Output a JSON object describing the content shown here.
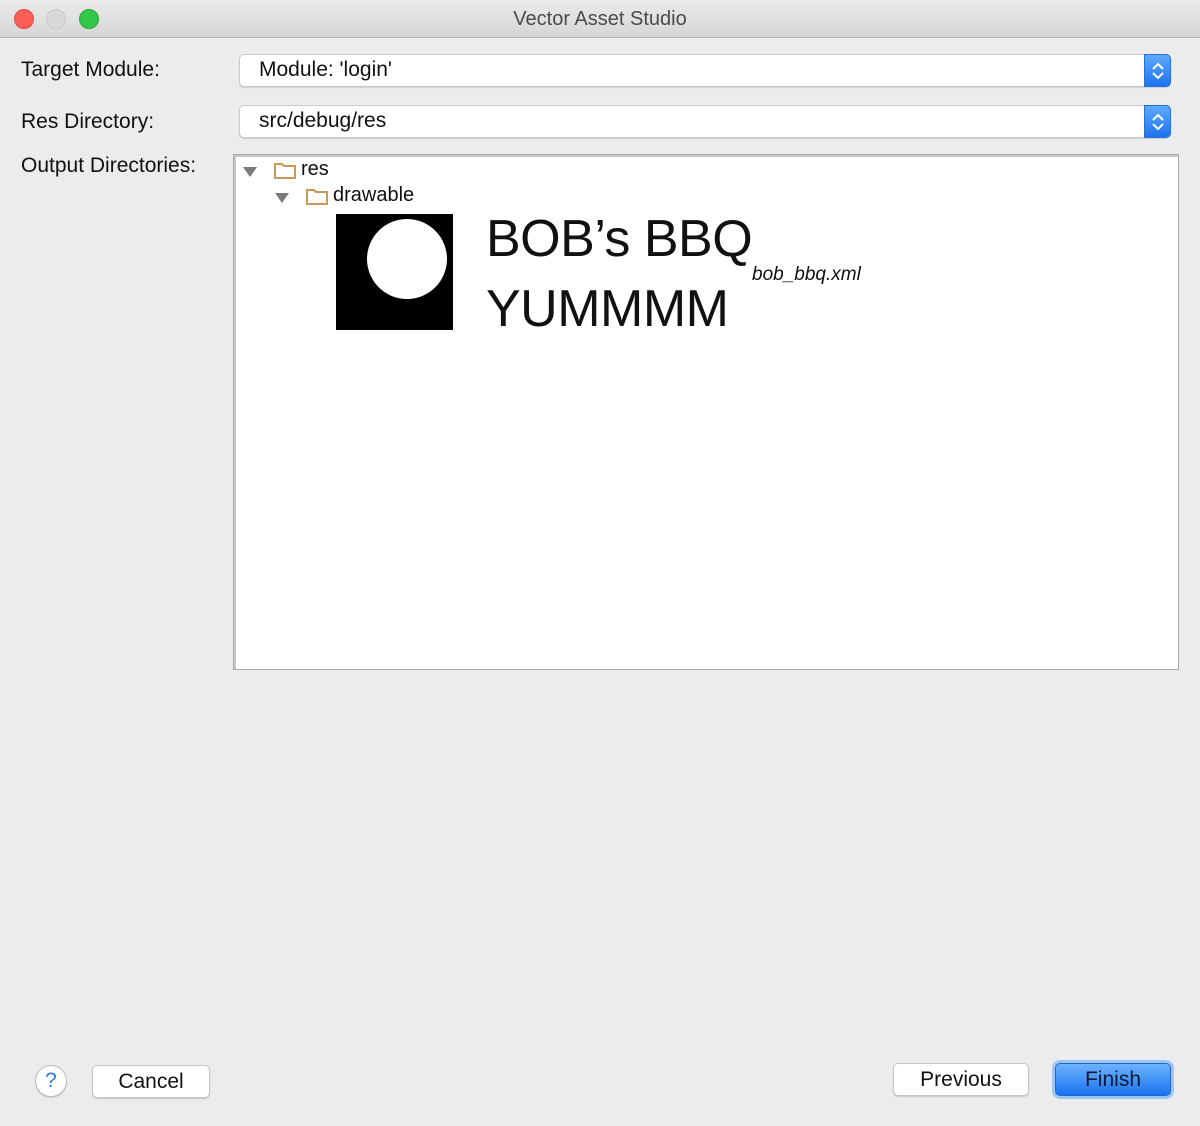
{
  "window": {
    "title": "Vector Asset Studio"
  },
  "form": {
    "target_module_label": "Target Module:",
    "target_module_value": "Module: 'login'",
    "res_directory_label": "Res Directory:",
    "res_directory_value": "src/debug/res",
    "output_directories_label": "Output Directories:"
  },
  "tree": {
    "root_label": "res",
    "child_label": "drawable",
    "preview": {
      "line1": "BOB’s BBQ",
      "line2": "YUMMMM",
      "file_name": "bob_bbq.xml"
    }
  },
  "footer": {
    "help_label": "?",
    "cancel_label": "Cancel",
    "previous_label": "Previous",
    "finish_label": "Finish"
  },
  "colors": {
    "accent": "#1a73f0",
    "close": "#fc5f57",
    "maximize": "#33c748",
    "folder": "#c79a5c"
  }
}
